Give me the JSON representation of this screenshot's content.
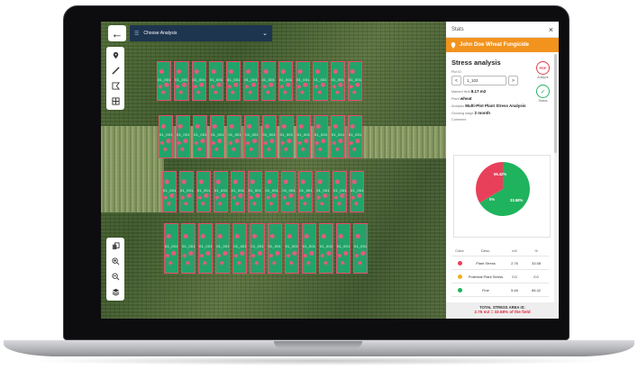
{
  "header": {
    "back_arrow": "←",
    "analysis_label": "Choose Analysis",
    "chevron": "⌄"
  },
  "map": {
    "plot_label": "01_001",
    "tools_top": [
      "location-pin-icon",
      "ruler-icon",
      "polygon-icon",
      "grid-select-icon"
    ],
    "tools_bottom": [
      "layers-stack-icon",
      "zoom-in-icon",
      "zoom-out-icon",
      "basemap-icon"
    ]
  },
  "sidebar": {
    "title": "Stats",
    "close": "×",
    "field_name": "John Doe Wheat Fungicide",
    "section_title": "Stress analysis",
    "plot_id_label": "Plot ID",
    "plot_id_value": "1_102",
    "prev": "<",
    "next": ">",
    "marked_area_label": "Marked field",
    "marked_area_value": "8.17 m2",
    "plant_label": "Plant",
    "plant_value": "wheat",
    "analysis_label": "Analysis",
    "analysis_value": "Multi-Plot Plant Stress Analysis",
    "growing_stage_label": "Growing stage",
    "growing_stage_value": "2 month",
    "comment_label": "Comment",
    "pdf_label": "Analyze",
    "done_label": "Status",
    "table": {
      "headers": [
        "Color",
        "Desc.",
        "m2",
        "%"
      ],
      "rows": [
        {
          "color": "#e8405a",
          "desc": "Plant Stress",
          "m2": "2.76",
          "pct": "33.58"
        },
        {
          "color": "#f2b01e",
          "desc": "Potential Plant Stress",
          "m2": "0.0",
          "pct": "0.0"
        },
        {
          "color": "#1fb35d",
          "desc": "Fine",
          "m2": "5.46",
          "pct": "66.42"
        }
      ]
    },
    "total_title": "TOTAL STRESS AREA IS:",
    "total_value": "2.76 m2 = 33.58% of the field"
  },
  "chart_data": {
    "type": "pie",
    "categories": [
      "Fine",
      "Plant Stress",
      "Potential Plant Stress"
    ],
    "values": [
      66.42,
      33.58,
      0
    ],
    "labels": [
      "66.42%",
      "33.58%",
      "0%"
    ],
    "colors": [
      "#1fb35d",
      "#e8405a",
      "#f2b01e"
    ]
  }
}
